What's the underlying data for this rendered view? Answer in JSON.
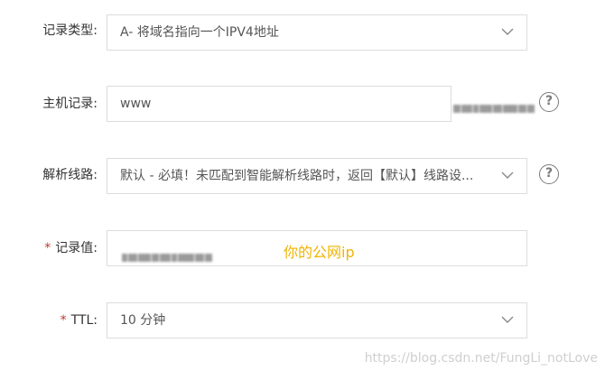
{
  "form": {
    "record_type": {
      "label": "记录类型:",
      "value": "A- 将域名指向一个IPV4地址"
    },
    "host_record": {
      "label": "主机记录:",
      "value": "www"
    },
    "resolution_line": {
      "label": "解析线路:",
      "value": "默认 - 必填！未匹配到智能解析线路时，返回【默认】线路设..."
    },
    "record_value": {
      "required_mark": "*",
      "label": "记录值:",
      "annotation": "你的公网ip"
    },
    "ttl": {
      "required_mark": "*",
      "label": "TTL:",
      "value": "10 分钟"
    },
    "help_symbol": "?"
  },
  "watermark": "https://blog.csdn.net/FungLi_notLove",
  "colors": {
    "border": "#dcdcdc",
    "annotation": "#f0b400",
    "required": "#c0392b",
    "text": "#333333"
  },
  "icons": [
    "chevron-down-icon",
    "help-icon"
  ]
}
